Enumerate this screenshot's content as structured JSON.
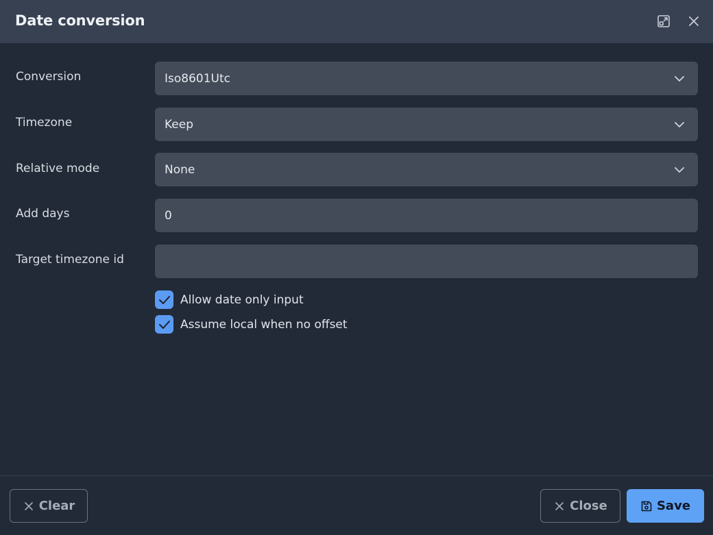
{
  "dialog": {
    "title": "Date conversion"
  },
  "fields": {
    "conversion": {
      "label": "Conversion",
      "value": "Iso8601Utc"
    },
    "timezone": {
      "label": "Timezone",
      "value": "Keep"
    },
    "relative_mode": {
      "label": "Relative mode",
      "value": "None"
    },
    "add_days": {
      "label": "Add days",
      "value": "0"
    },
    "target_timezone_id": {
      "label": "Target timezone id",
      "value": ""
    }
  },
  "checkboxes": {
    "allow_date_only": {
      "label": "Allow date only input",
      "checked": true
    },
    "assume_local": {
      "label": "Assume local when no offset",
      "checked": true
    }
  },
  "footer": {
    "clear_label": "Clear",
    "close_label": "Close",
    "save_label": "Save"
  },
  "colors": {
    "background": "#222a37",
    "titlebar": "#384152",
    "field": "#434b58",
    "accent": "#5ea2f5"
  },
  "icons": {
    "maximize": "maximize-icon",
    "close": "close-icon",
    "chevron": "chevron-down-icon",
    "check": "check-icon",
    "save": "floppy-disk-icon"
  }
}
